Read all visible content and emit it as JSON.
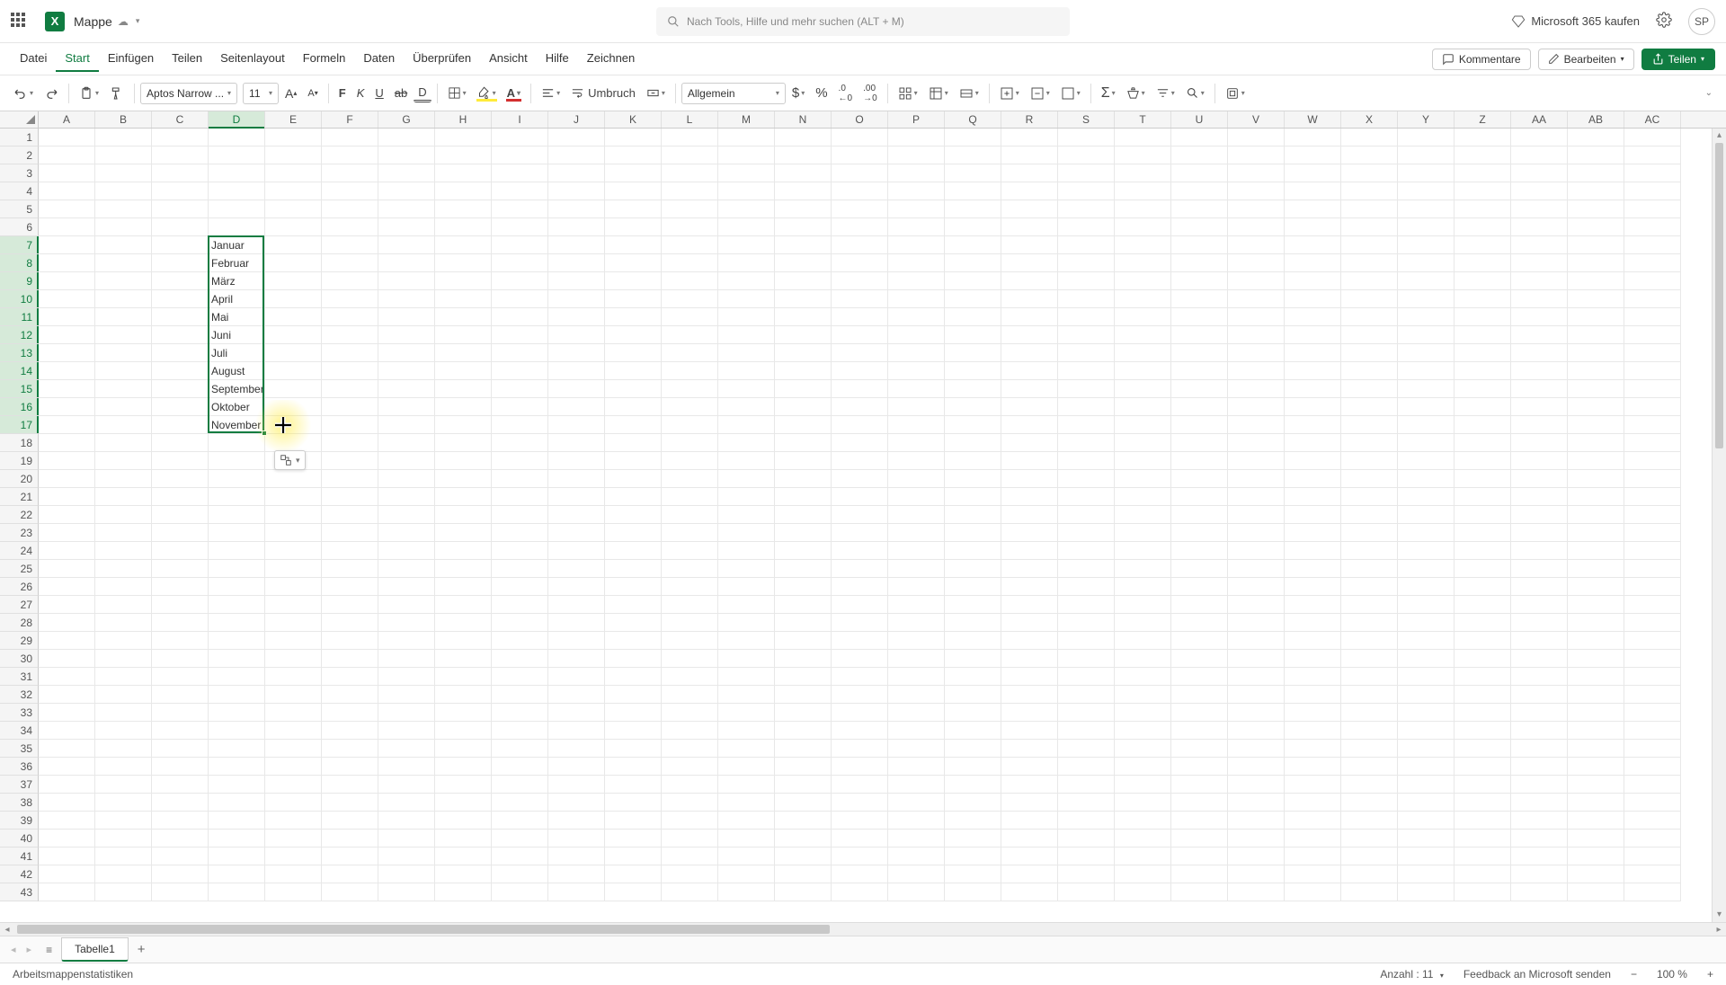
{
  "titlebar": {
    "doc_name": "Mappe",
    "search_placeholder": "Nach Tools, Hilfe und mehr suchen (ALT + M)",
    "buy_label": "Microsoft 365 kaufen",
    "avatar_initials": "SP"
  },
  "menubar": {
    "items": [
      "Datei",
      "Start",
      "Einfügen",
      "Teilen",
      "Seitenlayout",
      "Formeln",
      "Daten",
      "Überprüfen",
      "Ansicht",
      "Hilfe",
      "Zeichnen"
    ],
    "active_index": 1,
    "comments": "Kommentare",
    "edit": "Bearbeiten",
    "share": "Teilen"
  },
  "toolbar": {
    "font_name": "Aptos Narrow ...",
    "font_size": "11",
    "bold": "F",
    "italic": "K",
    "underline": "U",
    "wrap": "Umbruch",
    "number_format": "Allgemein"
  },
  "grid": {
    "columns": [
      "A",
      "B",
      "C",
      "D",
      "E",
      "F",
      "G",
      "H",
      "I",
      "J",
      "K",
      "L",
      "M",
      "N",
      "O",
      "P",
      "Q",
      "R",
      "S",
      "T",
      "U",
      "V",
      "W",
      "X",
      "Y",
      "Z",
      "AA",
      "AB",
      "AC"
    ],
    "selected_col_index": 3,
    "row_count": 43,
    "selected_row_start": 7,
    "selected_row_end": 17,
    "data_col": "D",
    "data_start_row": 7,
    "data": [
      "Januar",
      "Februar",
      "März",
      "April",
      "Mai",
      "Juni",
      "Juli",
      "August",
      "September",
      "Oktober",
      "November"
    ]
  },
  "autofill_options_label": "",
  "tabs": {
    "active": "Tabelle1"
  },
  "statusbar": {
    "stats_label": "Arbeitsmappenstatistiken",
    "count_label": "Anzahl : 11",
    "feedback": "Feedback an Microsoft senden",
    "zoom": "100 %"
  }
}
